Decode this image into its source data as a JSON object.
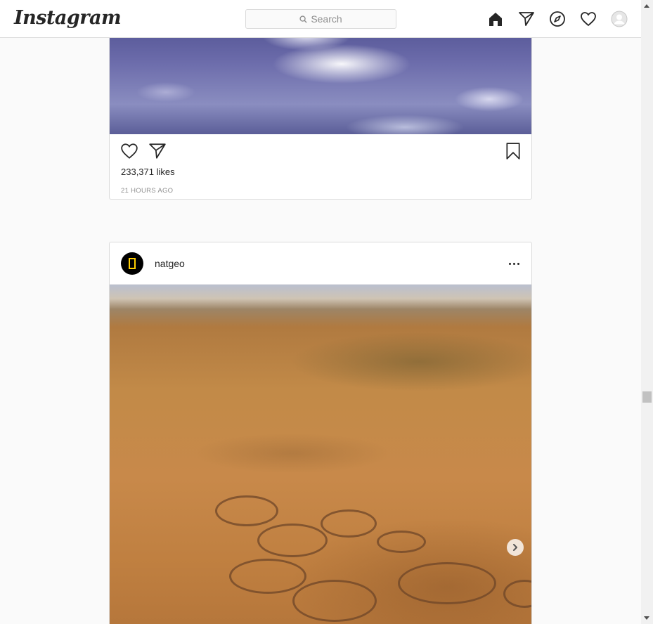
{
  "app": {
    "logo_text": "Instagram"
  },
  "header": {
    "search_placeholder": "Search",
    "icons": [
      "home-icon",
      "direct-icon",
      "explore-icon",
      "activity-heart-icon",
      "profile-avatar-icon"
    ]
  },
  "post_previous": {
    "likes": "233,371 likes",
    "time_ago": "21 HOURS AGO",
    "action_icons": [
      "like-heart-icon",
      "share-icon",
      "bookmark-icon"
    ]
  },
  "post_current": {
    "username": "natgeo",
    "more_icon": "more-options-icon",
    "carousel_next_icon": "chevron-right-icon"
  },
  "colors": {
    "border": "#dbdbdb",
    "text": "#262626",
    "muted": "#8e8e8e",
    "natgeo_yellow": "#ffce00"
  }
}
